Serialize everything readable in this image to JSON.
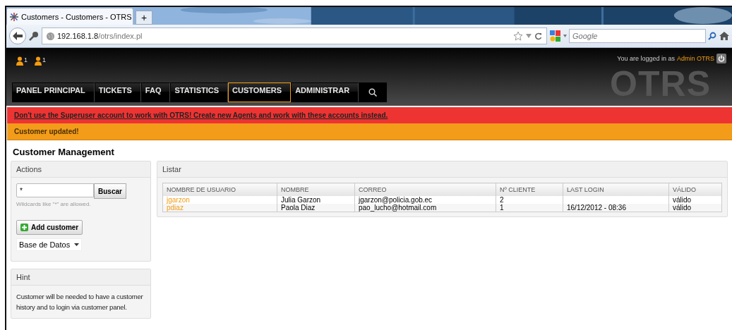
{
  "browser": {
    "tab_title": "Customers - Customers - OTRS",
    "new_tab": "+",
    "url_host": "192.168.1.8",
    "url_path": "/otrs/index.pl",
    "search_placeholder": "Google"
  },
  "header": {
    "notifications": [
      {
        "count": "1"
      },
      {
        "count": "1"
      }
    ],
    "logo": "OTRS",
    "logged_in_text": "You are logged in as",
    "user": "Admin OTRS"
  },
  "nav": [
    {
      "label": "PANEL PRINCIPAL",
      "selected": false
    },
    {
      "label": "TICKETS",
      "selected": false
    },
    {
      "label": "FAQ",
      "selected": false
    },
    {
      "label": "STATISTICS",
      "selected": false
    },
    {
      "label": "CUSTOMERS",
      "selected": true
    },
    {
      "label": "ADMINISTRAR",
      "selected": false
    }
  ],
  "alerts": [
    {
      "kind": "error",
      "text": "Don't use the Superuser account to work with OTRS! Create new Agents and work with these accounts instead."
    },
    {
      "kind": "notice",
      "text": "Customer updated!"
    }
  ],
  "page_title": "Customer Management",
  "actions": {
    "title": "Actions",
    "search_value": "*",
    "search_button": "Buscar",
    "search_hint": "Wildcards like \"*\" are allowed.",
    "add_button": "Add customer",
    "source": "Base de Datos"
  },
  "hint": {
    "title": "Hint",
    "text": "Customer will be needed to have a customer history and to login via customer panel."
  },
  "list": {
    "title": "Listar",
    "columns": [
      "NOMBRE DE USUARIO",
      "NOMBRE",
      "CORREO",
      "Nº CLIENTE",
      "LAST LOGIN",
      "VÁLIDO"
    ],
    "rows": [
      [
        "jgarzon",
        "Julia Garzon",
        "jgarzon@policia.gob.ec",
        "2",
        "",
        "válido"
      ],
      [
        "pdiaz",
        "Paola Diaz",
        "pao_lucho@hotmail.com",
        "1",
        "16/12/2012 - 08:36",
        "válido"
      ]
    ]
  }
}
